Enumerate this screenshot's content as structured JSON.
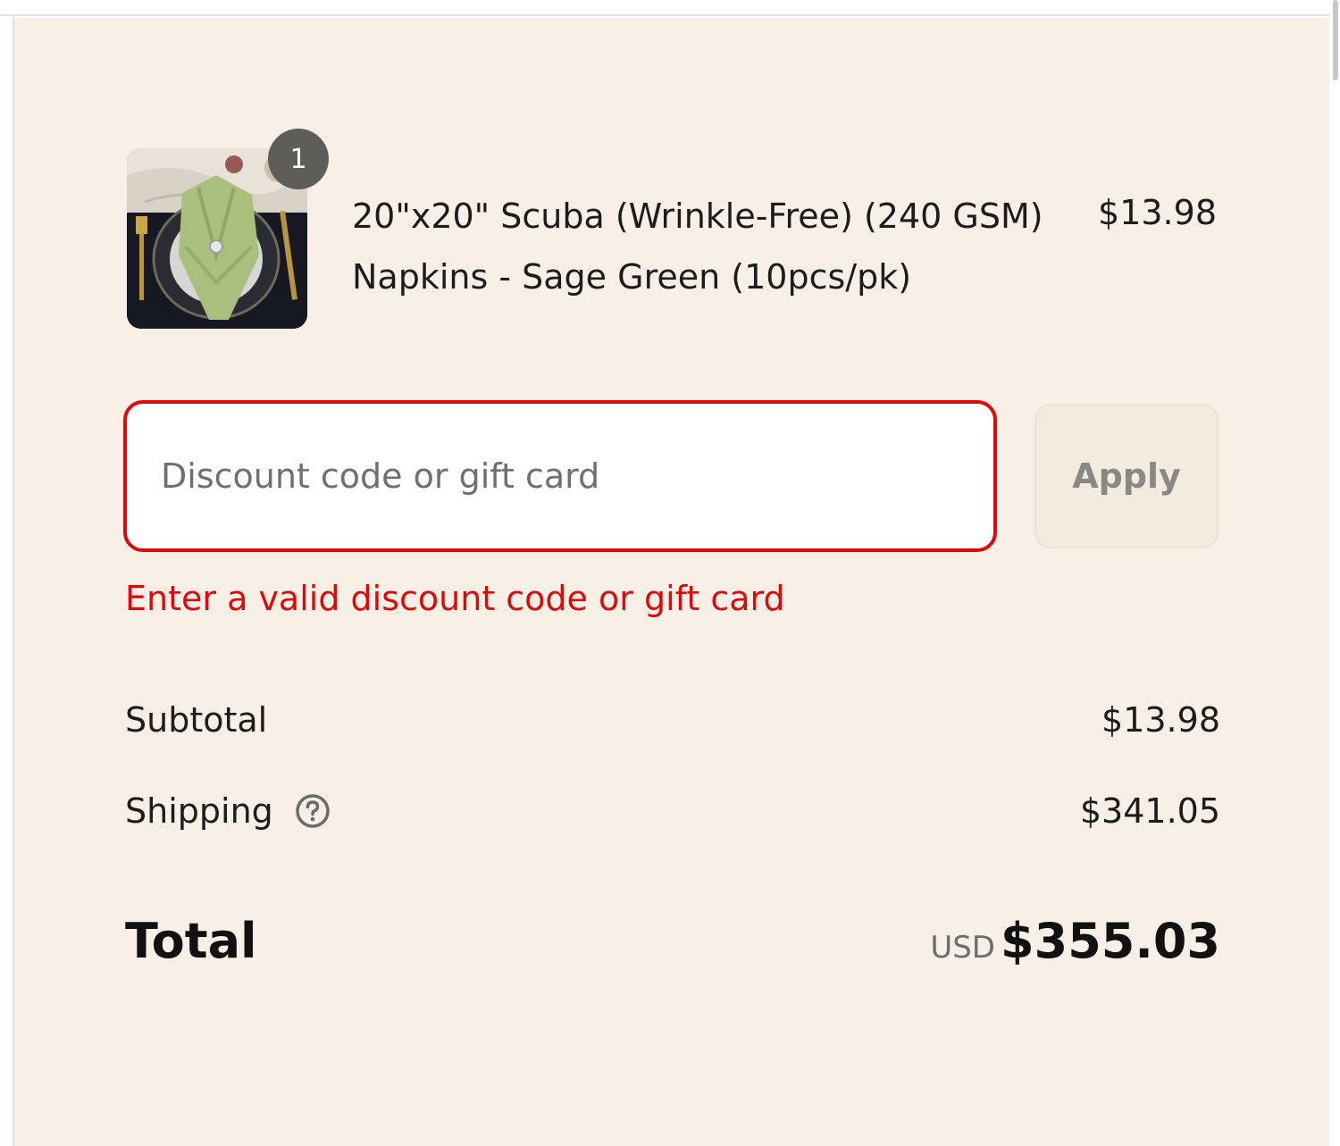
{
  "order_summary": {
    "line_items": [
      {
        "name": "20\"x20\" Scuba (Wrinkle-Free) (240 GSM) Napkins - Sage Green (10pcs/pk)",
        "price": "$13.98",
        "quantity": "1",
        "image_icon": "napkin-product-image"
      }
    ],
    "discount": {
      "placeholder": "Discount code or gift card",
      "value": "",
      "apply_label": "Apply",
      "error": "Enter a valid discount code or gift card"
    },
    "subtotal": {
      "label": "Subtotal",
      "value": "$13.98"
    },
    "shipping": {
      "label": "Shipping",
      "value": "$341.05",
      "help_icon": "question-circle-icon"
    },
    "total": {
      "label": "Total",
      "currency": "USD",
      "value": "$355.03"
    }
  },
  "colors": {
    "panel_background": "#f8f0e6",
    "error": "#dc0b0b",
    "text": "#1c1c1c",
    "badge": "#5f5d5a"
  }
}
